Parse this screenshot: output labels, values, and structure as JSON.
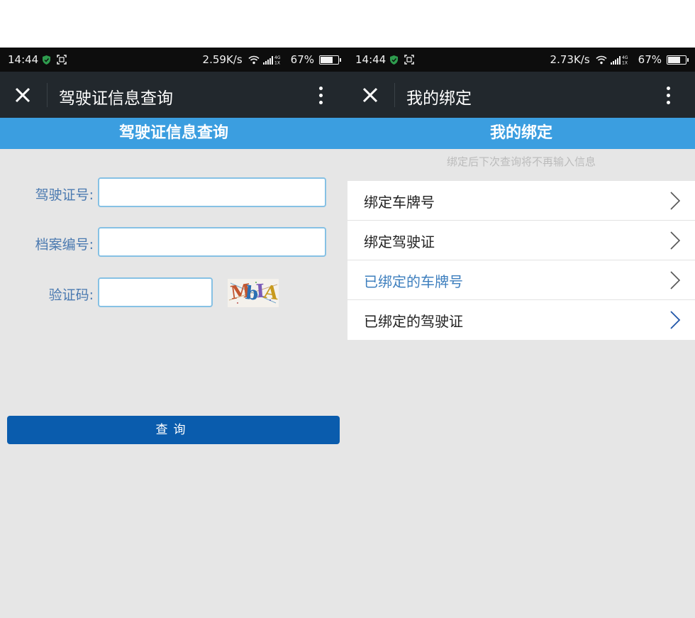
{
  "left_screen": {
    "status": {
      "time": "14:44",
      "speed": "2.59K/s",
      "network": "4G 1X",
      "battery_text": "67%",
      "battery_level": 0.67
    },
    "titlebar": {
      "title": "驾驶证信息查询"
    },
    "page_header": "驾驶证信息查询",
    "form": {
      "license_label": "驾驶证号:",
      "license_value": "",
      "file_label": "档案编号:",
      "file_value": "",
      "captcha_label": "验证码:",
      "captcha_value": "",
      "captcha_text": "MbIA"
    },
    "submit_label": "查询"
  },
  "right_screen": {
    "status": {
      "time": "14:44",
      "speed": "2.73K/s",
      "network": "4G 1X",
      "battery_text": "67%",
      "battery_level": 0.67
    },
    "titlebar": {
      "title": "我的绑定"
    },
    "page_header": "我的绑定",
    "hint": "绑定后下次查询将不再输入信息",
    "items": [
      {
        "label": "绑定车牌号"
      },
      {
        "label": "绑定驾驶证"
      },
      {
        "label": "已绑定的车牌号"
      },
      {
        "label": "已绑定的驾驶证"
      }
    ]
  },
  "colors": {
    "header_blue": "#3b9ee0",
    "button_blue": "#0a5cad",
    "label_blue": "#4a79b0",
    "titlebar": "#22282d",
    "statusbar": "#0d0d0d"
  },
  "icons": [
    "shield-icon",
    "screenshot-icon",
    "wifi-icon",
    "signal-icon",
    "battery-icon",
    "close-icon",
    "more-vertical-icon",
    "chevron-right-icon"
  ]
}
